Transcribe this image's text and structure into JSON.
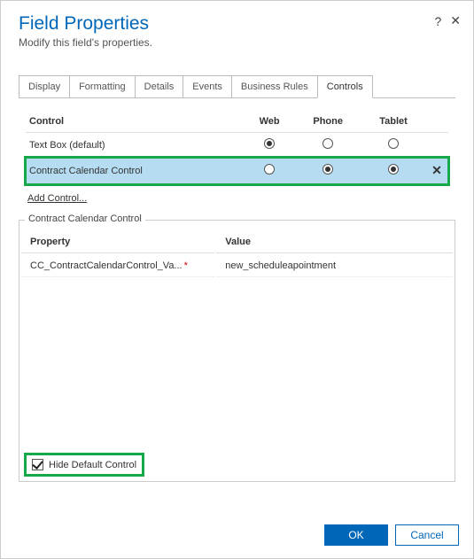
{
  "header": {
    "title": "Field Properties",
    "subtitle": "Modify this field's properties."
  },
  "tabs": {
    "items": [
      {
        "label": "Display"
      },
      {
        "label": "Formatting"
      },
      {
        "label": "Details"
      },
      {
        "label": "Events"
      },
      {
        "label": "Business Rules"
      },
      {
        "label": "Controls"
      }
    ],
    "active_index": 5
  },
  "controls_table": {
    "headers": {
      "control": "Control",
      "web": "Web",
      "phone": "Phone",
      "tablet": "Tablet"
    },
    "rows": [
      {
        "label": "Text Box (default)",
        "web": true,
        "phone": false,
        "tablet": false,
        "removable": false,
        "selected": false,
        "highlighted": false
      },
      {
        "label": "Contract Calendar Control",
        "web": false,
        "phone": true,
        "tablet": true,
        "removable": true,
        "selected": true,
        "highlighted": true
      }
    ],
    "add_link": "Add Control..."
  },
  "detail_group": {
    "legend": "Contract Calendar Control",
    "headers": {
      "property": "Property",
      "value": "Value"
    },
    "rows": [
      {
        "property": "CC_ContractCalendarControl_Va...",
        "required": true,
        "value": "new_scheduleapointment"
      }
    ],
    "hide_default": {
      "label": "Hide Default Control",
      "checked": true,
      "highlighted": true
    }
  },
  "footer": {
    "ok": "OK",
    "cancel": "Cancel"
  }
}
